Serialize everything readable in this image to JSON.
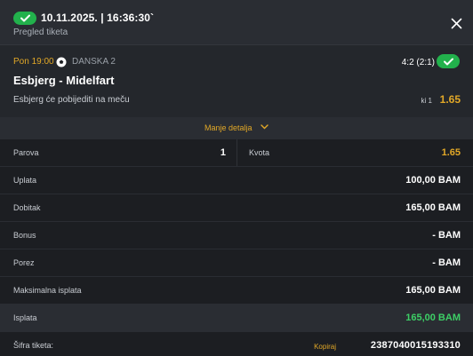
{
  "header": {
    "title": "10.11.2025. | 16:36:30`",
    "subtitle": "Pregled tiketa",
    "status_icon": "check-icon",
    "close_icon": "close-icon"
  },
  "match": {
    "time": "Pon 19:00",
    "sport_icon": "soccer-ball-icon",
    "league": "DANSKA 2",
    "score": "4:2 (2:1)",
    "teams": "Esbjerg - Midelfart",
    "pick": "Esbjerg će pobijediti na meču",
    "market": "ki 1",
    "odd": "1.65"
  },
  "toggle": {
    "label": "Manje detalja",
    "icon": "chevron-down-icon"
  },
  "summary": {
    "pairs_label": "Parova",
    "pairs_value": "1",
    "odds_label": "Kvota",
    "odds_value": "1.65",
    "stake_label": "Uplata",
    "stake_value": "100,00 BAM",
    "win_label": "Dobitak",
    "win_value": "165,00 BAM",
    "bonus_label": "Bonus",
    "bonus_value": "- BAM",
    "tax_label": "Porez",
    "tax_value": "- BAM",
    "max_payout_label": "Maksimalna isplata",
    "max_payout_value": "165,00 BAM",
    "payout_label": "Isplata",
    "payout_value": "165,00 BAM",
    "ticket_code_label": "Šifra tiketa:",
    "copy_label": "Kopiraj",
    "ticket_code": "2387040015193310"
  },
  "colors": {
    "accent_gold": "#e2a827",
    "success_green": "#22b14c",
    "payout_green": "#3dcf66",
    "background": "#1c1e22"
  }
}
